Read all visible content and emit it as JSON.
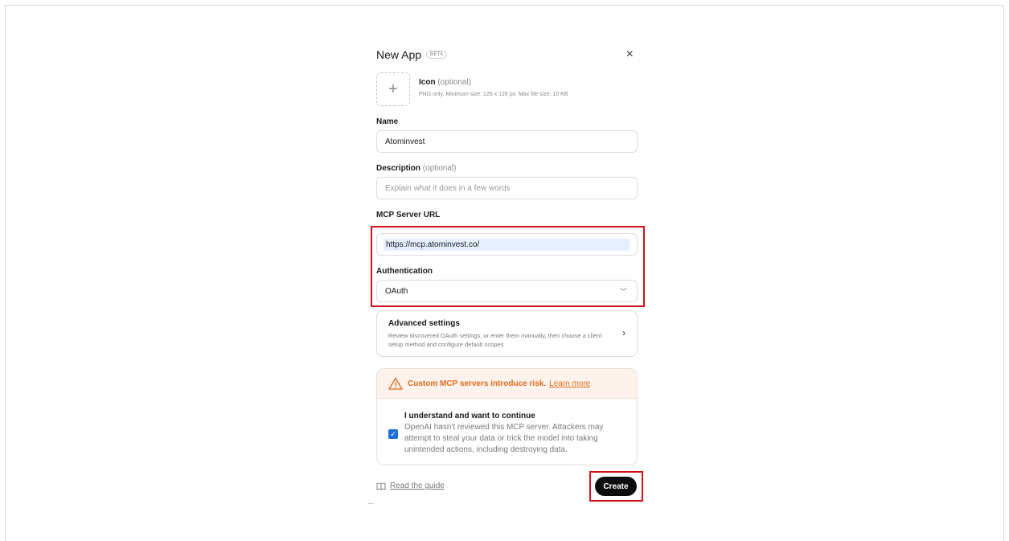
{
  "dialog": {
    "title": "New App",
    "badge": "BETA",
    "close_icon": "×"
  },
  "icon_upload": {
    "label": "Icon",
    "optional": "(optional)",
    "hint": "PNG only. Minimum size: 128 x 128 px. Max file size: 10 KB",
    "plus_icon": "+"
  },
  "name": {
    "label": "Name",
    "value": "Atominvest"
  },
  "description": {
    "label": "Description",
    "optional": "(optional)",
    "placeholder": "Explain what it does in a few words"
  },
  "mcp_server": {
    "label": "MCP Server URL",
    "value": "https://mcp.atominvest.co/"
  },
  "authentication": {
    "label": "Authentication",
    "selected": "OAuth",
    "chevron": "﹀"
  },
  "advanced": {
    "title": "Advanced settings",
    "description": "Review discovered OAuth settings, or enter them manually, then choose a client setup method and configure default scopes",
    "chevron": "›"
  },
  "warning": {
    "headline": "Custom MCP servers introduce risk.",
    "link": "Learn more",
    "checkbox_checked": true,
    "check_mark": "✓",
    "confirm_title": "I understand and want to continue",
    "confirm_desc": "OpenAI hasn't reviewed this MCP server. Attackers may attempt to steal your data or trick the model into taking unintended actions, including destroying data."
  },
  "footer": {
    "guide": "Read the guide",
    "create": "Create"
  },
  "colors": {
    "highlight": "#d0101b",
    "warning": "#e06a1d",
    "checkbox": "#1e6fd9",
    "primary_button": "#0d0d0d"
  }
}
